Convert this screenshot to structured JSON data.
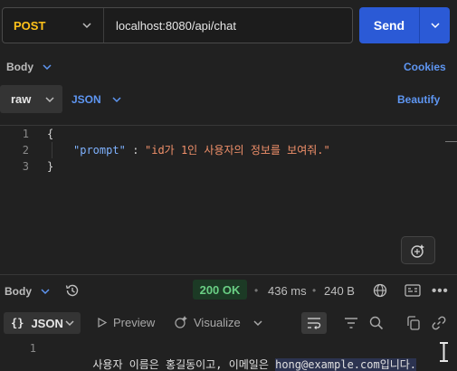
{
  "request": {
    "method": "POST",
    "url": "localhost:8080/api/chat",
    "send_label": "Send"
  },
  "body_bar": {
    "label": "Body",
    "cookies_label": "Cookies",
    "raw_label": "raw",
    "format_label": "JSON",
    "beautify_label": "Beautify"
  },
  "editor": {
    "lines": [
      {
        "num": "1",
        "text": "{"
      },
      {
        "num": "2",
        "key": "\"prompt\"",
        "sep": " : ",
        "value": "\"id가 1인 사용자의 정보를 보여줘.\""
      },
      {
        "num": "3",
        "text": "}"
      }
    ]
  },
  "response": {
    "body_label": "Body",
    "status": "200 OK",
    "time": "436 ms",
    "size": "240 B",
    "format_label": "JSON",
    "preview_label": "Preview",
    "visualize_label": "Visualize",
    "line_num": "1",
    "text_before": "사용자 이름은 홍길동이고, 이메일은 ",
    "text_highlight": "hong@example.com입니다."
  },
  "colors": {
    "method": "#ffc21a",
    "send": "#2b5ad6",
    "link": "#5e96f2",
    "status_ok": "#6acf84",
    "json_key": "#7fb2ff",
    "json_string": "#f0906a"
  }
}
